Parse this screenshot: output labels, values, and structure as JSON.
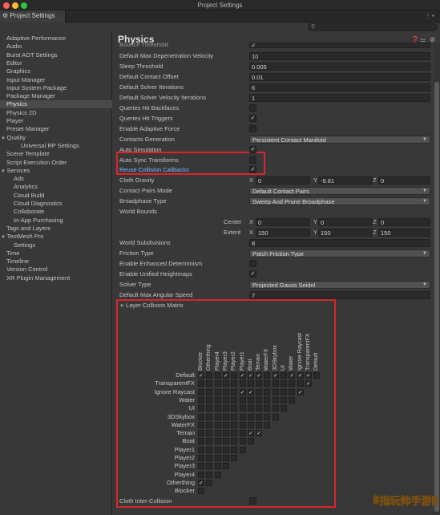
{
  "window": {
    "title": "Project Settings"
  },
  "tab": {
    "label": "Project Settings",
    "icon": "gear-icon"
  },
  "search": {
    "placeholder": ""
  },
  "sidebar": [
    {
      "label": "Adaptive Performance",
      "indent": 0
    },
    {
      "label": "Audio",
      "indent": 0
    },
    {
      "label": "Burst AOT Settings",
      "indent": 0
    },
    {
      "label": "Editor",
      "indent": 0
    },
    {
      "label": "Graphics",
      "indent": 0
    },
    {
      "label": "Input Manager",
      "indent": 0
    },
    {
      "label": "Input System Package",
      "indent": 0
    },
    {
      "label": "Package Manager",
      "indent": 0
    },
    {
      "label": "Physics",
      "indent": 0,
      "selected": true
    },
    {
      "label": "Physics 2D",
      "indent": 0
    },
    {
      "label": "Player",
      "indent": 0
    },
    {
      "label": "Preset Manager",
      "indent": 0
    },
    {
      "label": "Quality",
      "indent": 0,
      "arrow": true
    },
    {
      "label": "Universal RP Settings",
      "indent": 2
    },
    {
      "label": "Scene Template",
      "indent": 0
    },
    {
      "label": "Script Execution Order",
      "indent": 0
    },
    {
      "label": "Services",
      "indent": 0,
      "arrow": true
    },
    {
      "label": "Ads",
      "indent": 1
    },
    {
      "label": "Analytics",
      "indent": 1
    },
    {
      "label": "Cloud Build",
      "indent": 1
    },
    {
      "label": "Cloud Diagnostics",
      "indent": 1
    },
    {
      "label": "Collaborate",
      "indent": 1
    },
    {
      "label": "In-App Purchasing",
      "indent": 1
    },
    {
      "label": "Tags and Layers",
      "indent": 0
    },
    {
      "label": "TextMesh Pro",
      "indent": 0,
      "arrow": true
    },
    {
      "label": "Settings",
      "indent": 1
    },
    {
      "label": "Time",
      "indent": 0
    },
    {
      "label": "Timeline",
      "indent": 0
    },
    {
      "label": "Version Control",
      "indent": 0
    },
    {
      "label": "XR Plugin Management",
      "indent": 0
    }
  ],
  "main": {
    "title": "Physics",
    "bounce_threshold": {
      "label": "Bounce Threshold",
      "value": "2"
    },
    "settings": [
      {
        "label": "Default Max Depenetration Velocity",
        "value": "10",
        "kind": "field"
      },
      {
        "label": "Sleep Threshold",
        "value": "0.005",
        "kind": "field"
      },
      {
        "label": "Default Contact Offset",
        "value": "0.01",
        "kind": "field"
      },
      {
        "label": "Default Solver Iterations",
        "value": "6",
        "kind": "field"
      },
      {
        "label": "Default Solver Velocity Iterations",
        "value": "1",
        "kind": "field"
      },
      {
        "label": "Queries Hit Backfaces",
        "checked": false,
        "kind": "check"
      },
      {
        "label": "Queries Hit Triggers",
        "checked": true,
        "kind": "check"
      },
      {
        "label": "Enable Adaptive Force",
        "checked": false,
        "kind": "check"
      },
      {
        "label": "Contacts Generation",
        "value": "Persistent Contact Manifold",
        "kind": "dropdown"
      },
      {
        "label": "Auto Simulation",
        "checked": true,
        "kind": "check"
      },
      {
        "label": "Auto Sync Transforms",
        "checked": false,
        "kind": "check"
      },
      {
        "label": "Reuse Collision Callbacks",
        "checked": true,
        "kind": "check",
        "highlight": true
      }
    ],
    "cloth_gravity": {
      "label": "Cloth Gravity",
      "x": "0",
      "y": "-9.81",
      "z": "0"
    },
    "contact_pairs_mode": {
      "label": "Contact Pairs Mode",
      "value": "Default Contact Pairs"
    },
    "broadphase_type": {
      "label": "Broadphase Type",
      "value": "Sweep And Prune Broadphase"
    },
    "world_bounds": {
      "label": "World Bounds",
      "center_label": "Center",
      "center": {
        "x": "0",
        "y": "0",
        "z": "0"
      },
      "extent_label": "Extent",
      "extent": {
        "x": "150",
        "y": "150",
        "z": "150"
      }
    },
    "world_subdivisions": {
      "label": "World Subdivisions",
      "value": "8"
    },
    "friction_type": {
      "label": "Friction Type",
      "value": "Patch Friction Type"
    },
    "enhanced_determinism": {
      "label": "Enable Enhanced Determinism",
      "checked": false
    },
    "unified_heightmaps": {
      "label": "Enable Unified Heightmaps",
      "checked": true
    },
    "solver_type": {
      "label": "Solver Type",
      "value": "Projected Gauss Seidel"
    },
    "max_angular_speed": {
      "label": "Default Max Angular Speed",
      "value": "7"
    },
    "matrix": {
      "title": "Layer Collision Matrix",
      "layers": [
        "Default",
        "TransparentFX",
        "Ignore Raycast",
        "Water",
        "UI",
        "3DSkybox",
        "WaterFX",
        "Terrain",
        "Boat",
        "Player1",
        "Player2",
        "Player3",
        "Player4",
        "Otherthing",
        "Blocker"
      ],
      "checked": [
        [
          0,
          0
        ],
        [
          0,
          3
        ],
        [
          0,
          5
        ],
        [
          0,
          6
        ],
        [
          0,
          7
        ],
        [
          0,
          9
        ],
        [
          0,
          11
        ],
        [
          0,
          12
        ],
        [
          0,
          13
        ],
        [
          1,
          13
        ],
        [
          2,
          5
        ],
        [
          2,
          6
        ],
        [
          2,
          12
        ],
        [
          2,
          13
        ],
        [
          3,
          13
        ],
        [
          4,
          13
        ],
        [
          5,
          10
        ],
        [
          5,
          11
        ],
        [
          5,
          12
        ],
        [
          5,
          13
        ],
        [
          6,
          13
        ],
        [
          7,
          6
        ],
        [
          7,
          7
        ],
        [
          7,
          13
        ],
        [
          8,
          7
        ],
        [
          8,
          13
        ],
        [
          9,
          13
        ],
        [
          10,
          13
        ],
        [
          11,
          13
        ],
        [
          12,
          13
        ],
        [
          13,
          13
        ],
        [
          13,
          0
        ]
      ]
    },
    "cloth_inter_collision": {
      "label": "Cloth Inter-Collision",
      "checked": false
    }
  },
  "colors": {
    "highlight": "#d8262c",
    "link_text": "#7fb4ff"
  }
}
